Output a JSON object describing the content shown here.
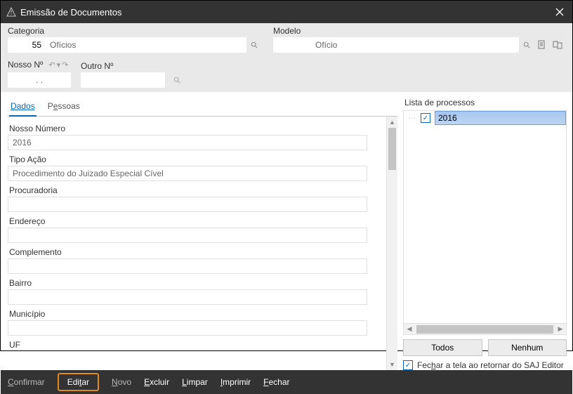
{
  "title": "Emissão de Documentos",
  "top": {
    "categoria_label": "Categoria",
    "categoria_code": "55",
    "categoria_name": "Ofícios",
    "modelo_label": "Modelo",
    "modelo_code": "",
    "modelo_name": "Ofício",
    "nosso_label": "Nosso Nº",
    "nosso_value": ". .",
    "outro_label": "Outro Nº",
    "outro_value": ""
  },
  "tabs": {
    "dados": "Dados",
    "pessoas": "Pessoas"
  },
  "form": {
    "nosso_numero_lbl": "Nosso Número",
    "nosso_numero_val": "2016",
    "tipo_acao_lbl": "Tipo Ação",
    "tipo_acao_val": "Procedimento do Juizado Especial Cível",
    "procuradoria_lbl": "Procuradoria",
    "procuradoria_val": "",
    "endereco_lbl": "Endereço",
    "endereco_val": "",
    "complemento_lbl": "Complemento",
    "complemento_val": "",
    "bairro_lbl": "Bairro",
    "bairro_val": "",
    "municipio_lbl": "Município",
    "municipio_val": "",
    "uf_lbl": "UF"
  },
  "right": {
    "header": "Lista de processos",
    "item1": "2016",
    "btn_todos": "Todos",
    "btn_nenhum": "Nenhum",
    "close_check": "Fechar a tela ao retornar do SAJ Editor"
  },
  "actions": {
    "confirmar": "Confirmar",
    "editar": "Editar",
    "novo": "Novo",
    "excluir": "Excluir",
    "limpar": "Limpar",
    "imprimir": "Imprimir",
    "fechar": "Fechar"
  }
}
